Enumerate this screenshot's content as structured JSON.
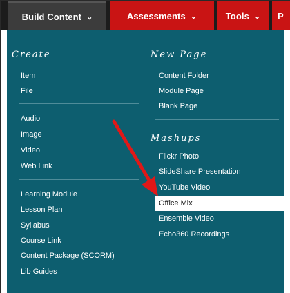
{
  "nav": {
    "tabs": [
      {
        "label": "Build Content",
        "chevron": "⌄"
      },
      {
        "label": "Assessments",
        "chevron": "⌄"
      },
      {
        "label": "Tools",
        "chevron": "⌄"
      },
      {
        "label": "P"
      }
    ]
  },
  "menu": {
    "create_heading": "Create",
    "create_group1": [
      "Item",
      "File"
    ],
    "create_group2": [
      "Audio",
      "Image",
      "Video",
      "Web Link"
    ],
    "create_group3": [
      "Learning Module",
      "Lesson Plan",
      "Syllabus",
      "Course Link",
      "Content Package (SCORM)",
      "Lib Guides"
    ],
    "newpage_heading": "New Page",
    "newpage_items": [
      "Content Folder",
      "Module Page",
      "Blank Page"
    ],
    "mashups_heading": "Mashups",
    "mashups_items": [
      "Flickr Photo",
      "SlideShare Presentation",
      "YouTube Video",
      "Office Mix",
      "Ensemble Video",
      "Echo360 Recordings"
    ]
  },
  "colors": {
    "menu_bg": "#0d5e6f",
    "tab_red": "#c91414",
    "active_tab": "#3c3c3c",
    "arrow": "#e01818",
    "highlight": "#ffffff"
  },
  "annotation": {
    "icon": "red-arrow-icon"
  }
}
